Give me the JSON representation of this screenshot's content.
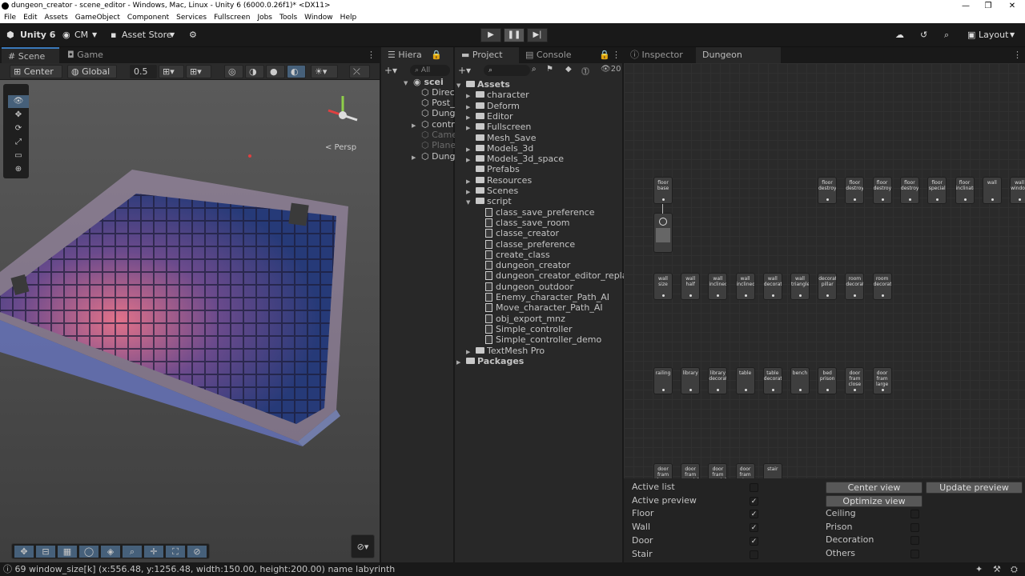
{
  "window": {
    "title": "dungeon_creator - scene_editor - Windows, Mac, Linux - Unity 6 (6000.0.26f1)* <DX11>"
  },
  "menu": [
    "File",
    "Edit",
    "Assets",
    "GameObject",
    "Component",
    "Services",
    "Fullscreen",
    "Jobs",
    "Tools",
    "Window",
    "Help"
  ],
  "toolbar": {
    "unity_label": "Unity 6",
    "account_label": "CM",
    "asset_store_label": "Asset Store",
    "layout_label": "Layout"
  },
  "scene_panel": {
    "tab_scene": "Scene",
    "tab_game": "Game",
    "pivot_label": "Center",
    "space_label": "Global",
    "snap_value": "0.5",
    "persp_label": "< Persp"
  },
  "hierarchy": {
    "tab_label": "Hiera",
    "search_placeholder": "All",
    "items": [
      "scei",
      "Direc",
      "Post_",
      "Dung",
      "contr",
      "Came",
      "Plane",
      "Dung"
    ]
  },
  "project": {
    "tab_project": "Project",
    "tab_console": "Console",
    "count_label": "20",
    "root": "Assets",
    "folders_top": [
      "character",
      "Deform",
      "Editor",
      "Fullscreen",
      "Mesh_Save",
      "Models_3d",
      "Models_3d_space",
      "Prefabs",
      "Resources",
      "Scenes",
      "script"
    ],
    "scripts": [
      "class_save_preference",
      "class_save_room",
      "classe_creator",
      "classe_preference",
      "create_class",
      "dungeon_creator",
      "dungeon_creator_editor_replace",
      "dungeon_outdoor",
      "Enemy_character_Path_AI",
      "Move_character_Path_AI",
      "obj_export_mnz",
      "Simple_controller",
      "Simple_controller_demo"
    ],
    "folders_bottom": [
      "TextMesh Pro"
    ],
    "packages": "Packages"
  },
  "dungeon_creator": {
    "tab_inspector": "Inspector",
    "tab_dungeon": "Dungeon Creator",
    "row1_nodes": [
      "floor base"
    ],
    "row1_right_nodes": [
      "floor destroy",
      "floor destroy",
      "floor destroy",
      "floor destroy",
      "floor special",
      "floor inclinate",
      "wall",
      "wall window"
    ],
    "row2_nodes": [
      "wall size",
      "wall half",
      "wall inclinec",
      "wall inclined",
      "wall decorati",
      "wall triangle",
      "decorati pillar",
      "room decorati",
      "room decorati"
    ],
    "row3_nodes": [
      "railing",
      "library",
      "library decorati",
      "table",
      "table decorati",
      "bench",
      "bed prison",
      "door fram close",
      "door fram large"
    ],
    "row4_nodes": [
      "door fram large",
      "door fram special",
      "door fram special",
      "door fram entrance",
      "stair"
    ],
    "options_left": [
      {
        "label": "Active list",
        "checked": false
      },
      {
        "label": "Active preview",
        "checked": true
      },
      {
        "label": "Floor",
        "checked": true
      },
      {
        "label": "Wall",
        "checked": true
      },
      {
        "label": "Door",
        "checked": true
      },
      {
        "label": "Stair",
        "checked": false
      }
    ],
    "options_right": [
      {
        "label": "Ceiling",
        "checked": false
      },
      {
        "label": "Prison",
        "checked": false
      },
      {
        "label": "Decoration",
        "checked": false
      },
      {
        "label": "Others",
        "checked": false
      }
    ],
    "btn_center_view": "Center view",
    "btn_update_preview": "Update preview",
    "btn_optimize_view": "Optimize view"
  },
  "status": {
    "text": "69  window_size[k]  (x:556.48, y:1256.48, width:150.00, height:200.00) name labyrinth"
  }
}
